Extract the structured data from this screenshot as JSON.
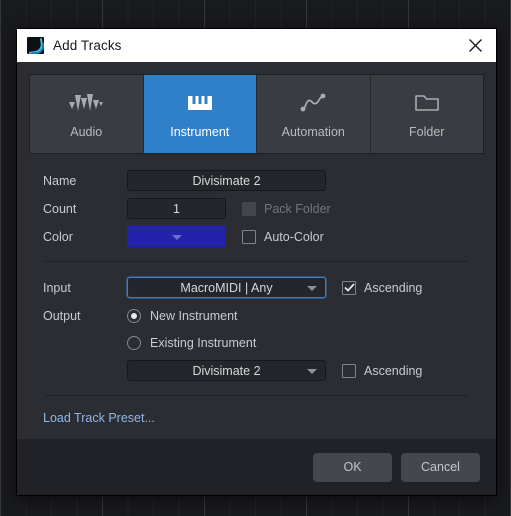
{
  "window": {
    "title": "Add Tracks",
    "app_icon": "waveform-app-icon",
    "close_icon": "close-icon"
  },
  "track_types": {
    "selected": "Instrument",
    "tabs": [
      {
        "label": "Audio",
        "icon": "waveform-icon"
      },
      {
        "label": "Instrument",
        "icon": "piano-keys-icon"
      },
      {
        "label": "Automation",
        "icon": "automation-curve-icon"
      },
      {
        "label": "Folder",
        "icon": "folder-icon"
      }
    ]
  },
  "form": {
    "name": {
      "label": "Name",
      "value": "Divisimate 2",
      "placeholder": "Name"
    },
    "count": {
      "label": "Count",
      "value": "1",
      "placeholder": "1"
    },
    "pack_folder": {
      "label": "Pack Folder",
      "checked": false,
      "disabled": true
    },
    "color": {
      "label": "Color",
      "swatch_hex": "#2222ad",
      "chevron_icon": "chevron-down-icon"
    },
    "auto_color": {
      "label": "Auto-Color",
      "checked": false
    },
    "input": {
      "label": "Input",
      "value": "MacroMIDI | Any",
      "focused": true,
      "chevron_icon": "chevron-down-icon"
    },
    "input_ascending": {
      "label": "Ascending",
      "checked": true
    },
    "output": {
      "label": "Output",
      "options": [
        {
          "label": "New Instrument",
          "selected": true
        },
        {
          "label": "Existing Instrument",
          "selected": false
        }
      ],
      "existing_value": "Divisimate 2",
      "chevron_icon": "chevron-down-icon"
    },
    "output_ascending": {
      "label": "Ascending",
      "checked": false
    },
    "load_preset_link": "Load Track Preset..."
  },
  "footer": {
    "ok_label": "OK",
    "cancel_label": "Cancel"
  },
  "colors": {
    "accent_blue": "#2f7fc9",
    "track_color": "#2222ad",
    "link_blue": "#8fb8e8",
    "panel_bg": "#2b2d33"
  }
}
